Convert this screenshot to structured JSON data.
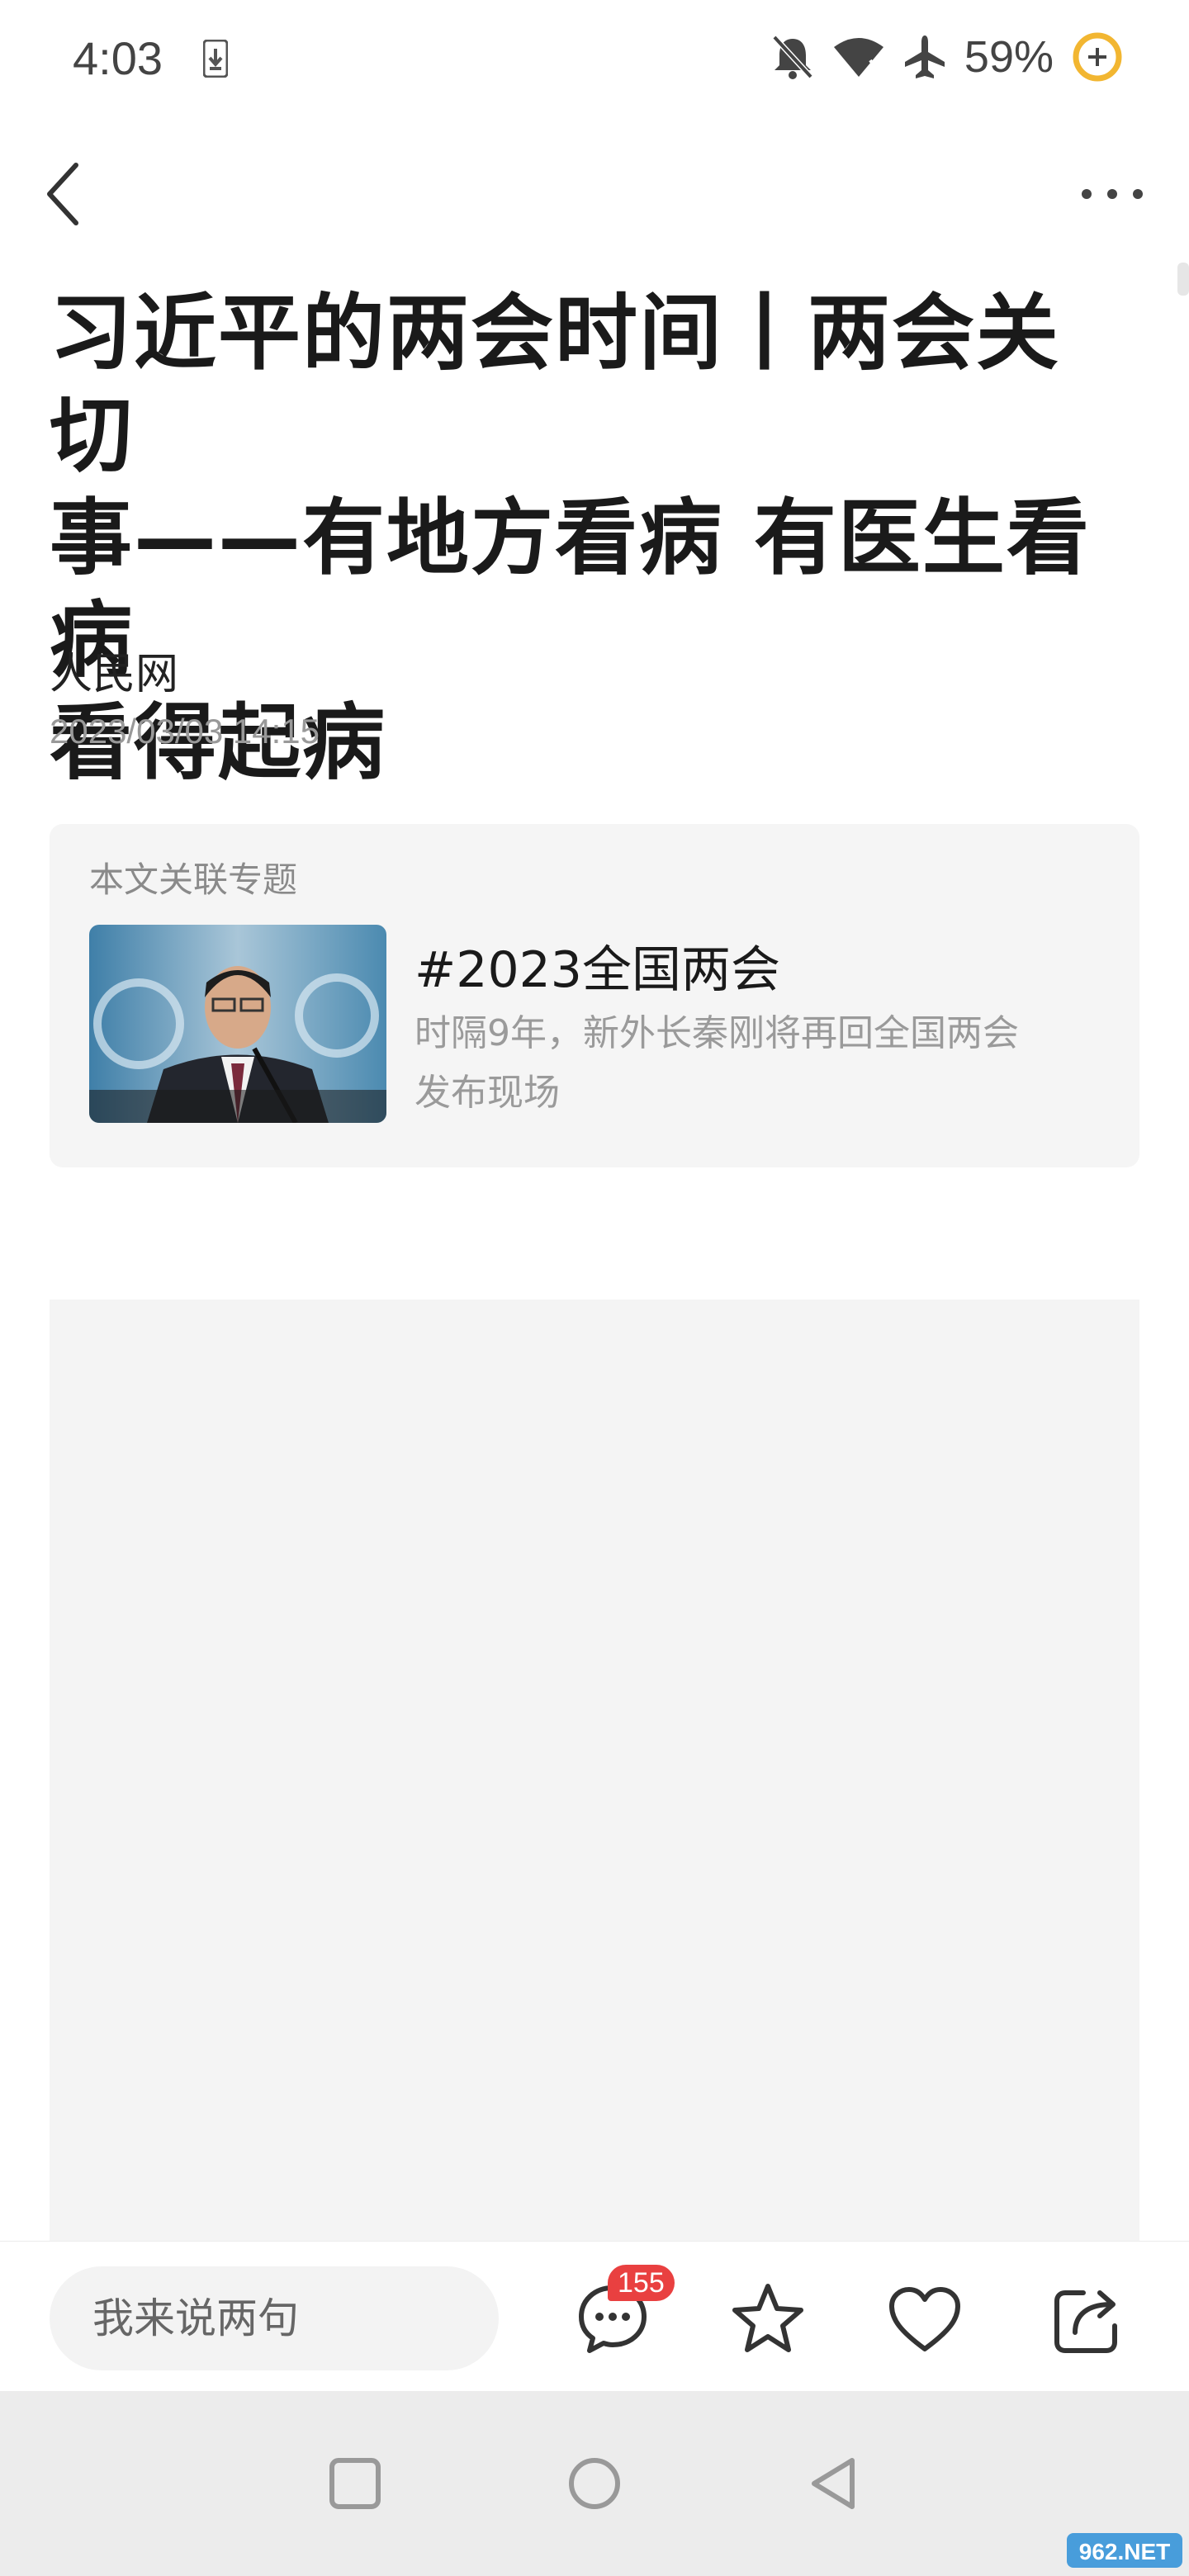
{
  "status_bar": {
    "time": "4:03",
    "battery_percent": "59%",
    "icons": [
      "download-icon",
      "bell-off-icon",
      "wifi-icon",
      "airplane-icon",
      "battery-saver-icon"
    ]
  },
  "nav": {
    "back_icon": "back-chevron-icon",
    "more_icon": "more-dots-icon"
  },
  "article": {
    "title_lines": [
      "习近平的两会时间丨两会关切",
      "事——有地方看病 有医生看病",
      "看得起病"
    ],
    "source": "人民网",
    "date": "2023/03/03 14:15"
  },
  "related_topic": {
    "label": "本文关联专题",
    "title": "#2023全国两会",
    "description_lines": [
      "时隔9年，新外长秦刚将再回全国两会",
      "发布现场"
    ]
  },
  "action_bar": {
    "comment_placeholder": "我来说两句",
    "comment_count": "155",
    "icons": [
      "comment-icon",
      "star-icon",
      "heart-icon",
      "share-icon"
    ]
  },
  "system_nav": {
    "icons": [
      "recents-square-icon",
      "home-circle-icon",
      "back-triangle-icon"
    ]
  },
  "watermark": "962.NET",
  "colors": {
    "badge": "#e94040",
    "card_bg": "#f5f5f5",
    "muted_text": "#999999",
    "battery_ring": "#f2b631"
  }
}
